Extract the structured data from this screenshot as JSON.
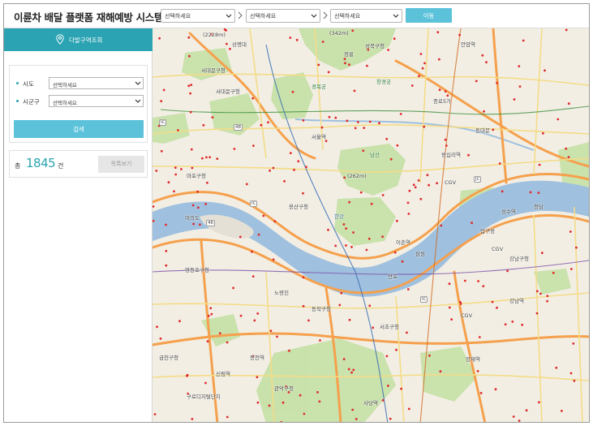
{
  "header": {
    "app_title": "이륜차 배달 플랫폼 재해예방 시스템",
    "selects": [
      "선택하세요",
      "선택하세요",
      "선택하세요"
    ],
    "move_label": "이동"
  },
  "sidebar": {
    "tab_label": "다발구역조회",
    "fields": [
      {
        "label": "시도",
        "value": "선택하세요"
      },
      {
        "label": "시군구",
        "value": "선택하세요"
      }
    ],
    "search_label": "검색",
    "count_prefix": "총",
    "count_value": "1845",
    "count_suffix": "건",
    "list_label": "목록보기"
  },
  "map": {
    "labels": [
      {
        "text": "(2228m)",
        "cls": ""
      },
      {
        "text": "(342m)",
        "cls": ""
      },
      {
        "text": "상명대",
        "cls": ""
      },
      {
        "text": "성북구청",
        "cls": ""
      },
      {
        "text": "정릉",
        "cls": ""
      },
      {
        "text": "안암역",
        "cls": ""
      },
      {
        "text": "서대문구청",
        "cls": ""
      },
      {
        "text": "서대문구청",
        "cls": ""
      },
      {
        "text": "경복궁",
        "cls": "green"
      },
      {
        "text": "창경궁",
        "cls": "green"
      },
      {
        "text": "종로5가",
        "cls": ""
      },
      {
        "text": "서울역",
        "cls": ""
      },
      {
        "text": "남산",
        "cls": "green"
      },
      {
        "text": "(262m)",
        "cls": ""
      },
      {
        "text": "용산구청",
        "cls": ""
      },
      {
        "text": "이촌역",
        "cls": ""
      },
      {
        "text": "여의도",
        "cls": ""
      },
      {
        "text": "한강",
        "cls": "river"
      },
      {
        "text": "영등포구청",
        "cls": ""
      },
      {
        "text": "동작구청",
        "cls": ""
      },
      {
        "text": "서초구청",
        "cls": ""
      },
      {
        "text": "강남구청",
        "cls": ""
      },
      {
        "text": "CGV",
        "cls": ""
      },
      {
        "text": "CGV",
        "cls": ""
      },
      {
        "text": "CGV",
        "cls": ""
      },
      {
        "text": "관악구청",
        "cls": ""
      },
      {
        "text": "사당역",
        "cls": ""
      },
      {
        "text": "양재역",
        "cls": ""
      },
      {
        "text": "금천구청",
        "cls": ""
      },
      {
        "text": "구로디지털단지",
        "cls": ""
      },
      {
        "text": "성수역",
        "cls": ""
      },
      {
        "text": "왕십리역",
        "cls": ""
      },
      {
        "text": "강남역",
        "cls": ""
      },
      {
        "text": "신림역",
        "cls": ""
      },
      {
        "text": "봉천역",
        "cls": ""
      },
      {
        "text": "동대문",
        "cls": ""
      },
      {
        "text": "마포구청",
        "cls": ""
      },
      {
        "text": "노량진",
        "cls": ""
      },
      {
        "text": "반포",
        "cls": ""
      },
      {
        "text": "잠원",
        "cls": ""
      },
      {
        "text": "압구정",
        "cls": ""
      },
      {
        "text": "청담",
        "cls": ""
      },
      {
        "text": "IC",
        "cls": "road"
      },
      {
        "text": "IC",
        "cls": "road"
      },
      {
        "text": "JC",
        "cls": "road"
      },
      {
        "text": "IC",
        "cls": "road"
      },
      {
        "text": "46",
        "cls": "road"
      },
      {
        "text": "48",
        "cls": "road"
      }
    ]
  },
  "colors": {
    "accent": "#5bc2da",
    "tab": "#2ba3b2",
    "river": "#9fc0de",
    "park": "#c5e0a5",
    "major_road": "#f5a04c",
    "minor_road": "#f4dc87",
    "hotspot": "#e02a2a"
  }
}
